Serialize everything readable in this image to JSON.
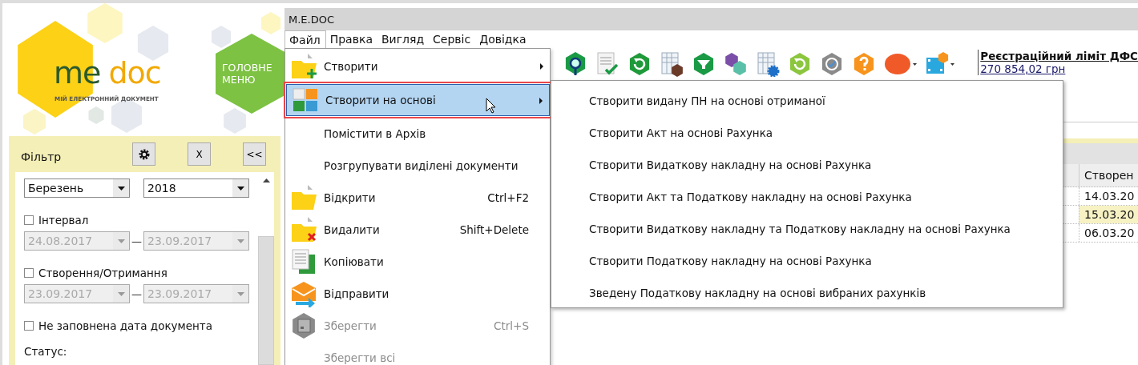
{
  "logo": {
    "word_1": "me",
    "word_2": "doc",
    "tagline": "МІЙ ЕЛЕКТРОННИЙ ДОКУМЕНТ"
  },
  "main_menu_button": {
    "label": "ГОЛОВНЕ МЕНЮ"
  },
  "filter": {
    "title": "Фільтр",
    "buttons": [
      {
        "kind": "settings"
      },
      {
        "kind": "text",
        "label": "X"
      },
      {
        "kind": "text",
        "label": "<<"
      }
    ],
    "month": "Березень",
    "year": "2018",
    "options": [
      {
        "label": "Інтервал",
        "checked": false,
        "from": "24.08.2017",
        "separator": "—",
        "to": "23.09.2017",
        "disabled": true
      },
      {
        "label": "Створення/Отримання",
        "checked": false,
        "from": "23.09.2017",
        "separator": "—",
        "to": "23.09.2017",
        "disabled": true
      },
      {
        "label": "Не заповнена дата документа",
        "checked": false
      }
    ],
    "status_label": "Статус:"
  },
  "window": {
    "title": "M.E.DOC"
  },
  "menu_bar": [
    {
      "label": "Файл",
      "selected": true
    },
    {
      "label": "Правка",
      "selected": false
    },
    {
      "label": "Вигляд",
      "selected": false
    },
    {
      "label": "Сервіс",
      "selected": false
    },
    {
      "label": "Довідка",
      "selected": false
    }
  ],
  "registration": {
    "title": "Реєстраційний ліміт ДФС",
    "amount": "270 854,02 грн"
  },
  "table": {
    "columns": [
      "Створен"
    ],
    "rows": [
      {
        "cells": [
          "14.03.20"
        ],
        "selected": false
      },
      {
        "cells": [
          "15.03.20"
        ],
        "selected": true
      },
      {
        "cells": [
          "06.03.20"
        ],
        "selected": false
      }
    ]
  },
  "file_menu": [
    {
      "label": "Створити",
      "submenu": true,
      "selected": false,
      "disabled": false
    },
    {
      "label": "Створити на основі",
      "submenu": true,
      "selected": true,
      "disabled": false
    },
    {
      "label": "Помістити в Архів",
      "submenu": false,
      "selected": false,
      "disabled": false
    },
    {
      "label": "Розгрупувати виділені документи",
      "submenu": false,
      "selected": false,
      "disabled": false
    },
    {
      "label": "Відкрити",
      "shortcut": "Ctrl+F2",
      "submenu": false,
      "selected": false,
      "disabled": false
    },
    {
      "label": "Видалити",
      "shortcut": "Shift+Delete",
      "submenu": false,
      "selected": false,
      "disabled": false
    },
    {
      "label": "Копіювати",
      "submenu": false,
      "selected": false,
      "disabled": false
    },
    {
      "label": "Відправити",
      "submenu": false,
      "selected": false,
      "disabled": false
    },
    {
      "label": "Зберегти",
      "shortcut": "Ctrl+S",
      "submenu": false,
      "selected": false,
      "disabled": true
    },
    {
      "label": "Зберегти всі",
      "submenu": false,
      "selected": false,
      "disabled": true
    }
  ],
  "submenu": [
    "Створити видану ПН на основі отриманої",
    "Створити Акт на основі Рахунка",
    "Створити Видаткову накладну на основі Рахунка",
    "Створити Акт та Податкову накладну на основі Рахунка",
    "Створити Видаткову накладну та Податкову накладну на основі Рахунка",
    "Створити Податкову накладну на основі Рахунка",
    "Зведену Податкову накладну на основі вибраних рахунків"
  ]
}
